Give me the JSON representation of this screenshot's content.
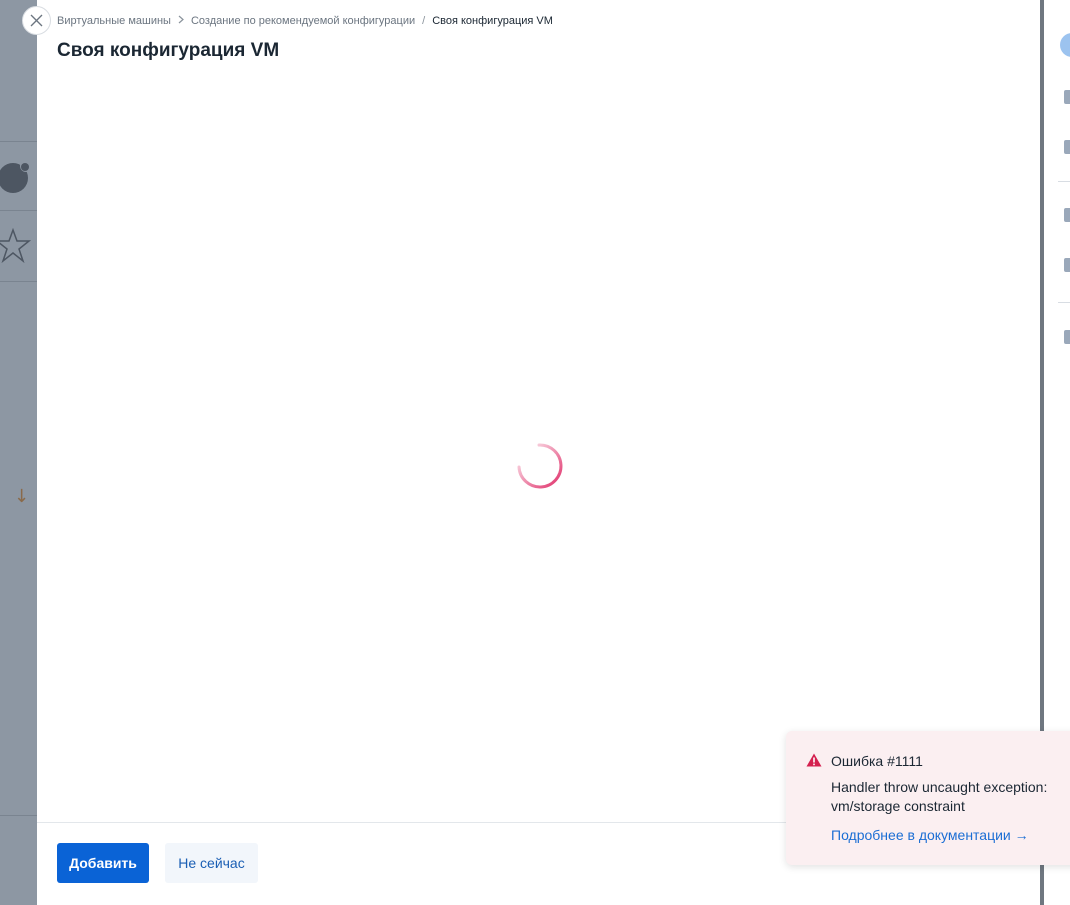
{
  "breadcrumb": {
    "items": [
      {
        "label": "Виртуальные машины"
      },
      {
        "label": "Создание по рекомендуемой конфигурации"
      },
      {
        "label": "Своя конфигурация VM"
      }
    ],
    "separators": [
      ">",
      "/"
    ]
  },
  "page": {
    "title": "Своя конфигурация VM"
  },
  "footer": {
    "primary_label": "Добавить",
    "secondary_label": "Не сейчас"
  },
  "toast": {
    "title": "Ошибка #1111",
    "message": "Handler throw uncaught exception: vm/storage constraint",
    "link_label": "Подробнее в документации →"
  },
  "icons": {
    "close": "close-icon",
    "spinner": "loading-spinner-icon",
    "warning": "warning-triangle-icon"
  },
  "colors": {
    "primary": "#0a63d6",
    "spinner": "#e0306a",
    "error_icon": "#d4204f",
    "toast_bg": "#fbeff1",
    "link": "#1b6ed4",
    "overlay": "#8e98a4"
  }
}
